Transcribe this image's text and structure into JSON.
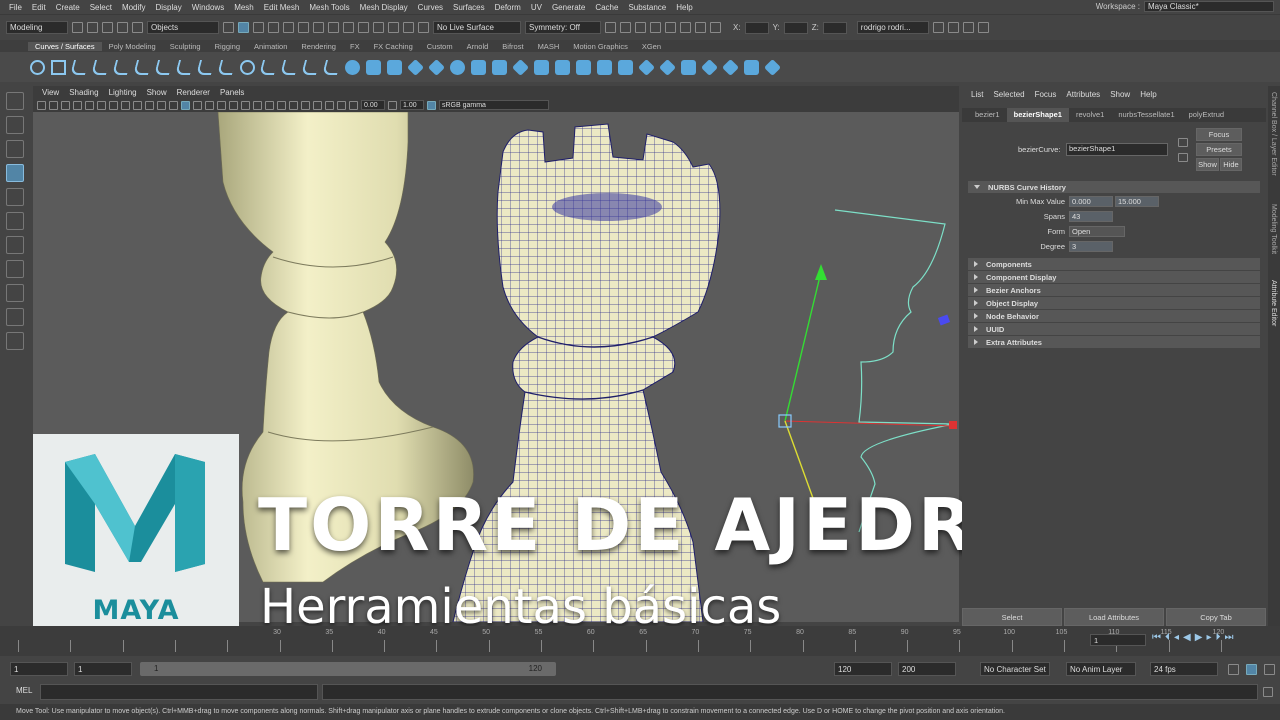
{
  "menubar": {
    "items": [
      "File",
      "Edit",
      "Create",
      "Select",
      "Modify",
      "Display",
      "Windows",
      "Mesh",
      "Edit Mesh",
      "Mesh Tools",
      "Mesh Display",
      "Curves",
      "Surfaces",
      "Deform",
      "UV",
      "Generate",
      "Cache",
      "Substance",
      "Help"
    ],
    "workspace_label": "Workspace :",
    "workspace_value": "Maya Classic*"
  },
  "statusline": {
    "mode": "Modeling",
    "select_mode": "Objects",
    "live_surface": "No Live Surface",
    "symmetry": "Symmetry: Off",
    "x_label": "X:",
    "y_label": "Y:",
    "z_label": "Z:",
    "user": "rodrigo rodri..."
  },
  "shelf": {
    "tabs": [
      "Curves / Surfaces",
      "Poly Modeling",
      "Sculpting",
      "Rigging",
      "Animation",
      "Rendering",
      "FX",
      "FX Caching",
      "Custom",
      "Arnold",
      "Bifrost",
      "MASH",
      "Motion Graphics",
      "XGen"
    ],
    "active_tab": "Curves / Surfaces"
  },
  "panel": {
    "menus": [
      "View",
      "Shading",
      "Lighting",
      "Show",
      "Renderer",
      "Panels"
    ],
    "exposure": "0.00",
    "gamma": "1.00",
    "color_space": "sRGB gamma"
  },
  "attribute_editor": {
    "menus": [
      "List",
      "Selected",
      "Focus",
      "Attributes",
      "Show",
      "Help"
    ],
    "tabs": [
      "bezier1",
      "bezierShape1",
      "revolve1",
      "nurbsTessellate1",
      "polyExtrud"
    ],
    "active_tab": "bezierShape1",
    "node_label": "bezierCurve:",
    "node_value": "bezierShape1",
    "buttons": {
      "focus": "Focus",
      "presets": "Presets",
      "show": "Show",
      "hide": "Hide"
    },
    "history_section": "NURBS Curve History",
    "min_max_label": "Min Max Value",
    "min_value": "0.000",
    "max_value": "15.000",
    "spans_label": "Spans",
    "spans_value": "43",
    "form_label": "Form",
    "form_value": "Open",
    "degree_label": "Degree",
    "degree_value": "3",
    "sections": [
      "Components",
      "Component Display",
      "Bezier Anchors",
      "Object Display",
      "Node Behavior",
      "UUID",
      "Extra Attributes"
    ],
    "bottom_buttons": [
      "Select",
      "Load Attributes",
      "Copy Tab"
    ]
  },
  "side_tabs": [
    "Channel Box / Layer Editor",
    "Modeling Toolkit",
    "Attribute Editor"
  ],
  "overlay": {
    "title": "TORRE DE AJEDREZ",
    "subtitle": "Herramientas básicas",
    "logo_text": "MAYA"
  },
  "timeline": {
    "tick_labels": [
      "30",
      "35",
      "40",
      "45",
      "50",
      "55",
      "60",
      "65",
      "70",
      "75",
      "80",
      "85",
      "90",
      "95",
      "100",
      "105",
      "110",
      "115",
      "120"
    ],
    "current_frame": "1"
  },
  "range": {
    "start": "1",
    "playback_start": "1",
    "slider_start": "1",
    "slider_end": "120",
    "playback_end": "120",
    "end": "200",
    "character_set": "No Character Set",
    "anim_layer": "No Anim Layer",
    "fps": "24 fps"
  },
  "mel": {
    "label": "MEL"
  },
  "help_line": "Move Tool: Use manipulator to move object(s). Ctrl+MMB+drag to move components along normals. Shift+drag manipulator axis or plane handles to extrude components or clone objects. Ctrl+Shift+LMB+drag to constrain movement to a connected edge. Use D or HOME to change the pivot position and axis orientation.",
  "colors": {
    "accent": "#5285a6",
    "maya_teal": "#1b8e9c",
    "rook_shaded": "#e2dfb2",
    "wireframe": "#2a2a8a",
    "curve": "#7de0c8"
  }
}
